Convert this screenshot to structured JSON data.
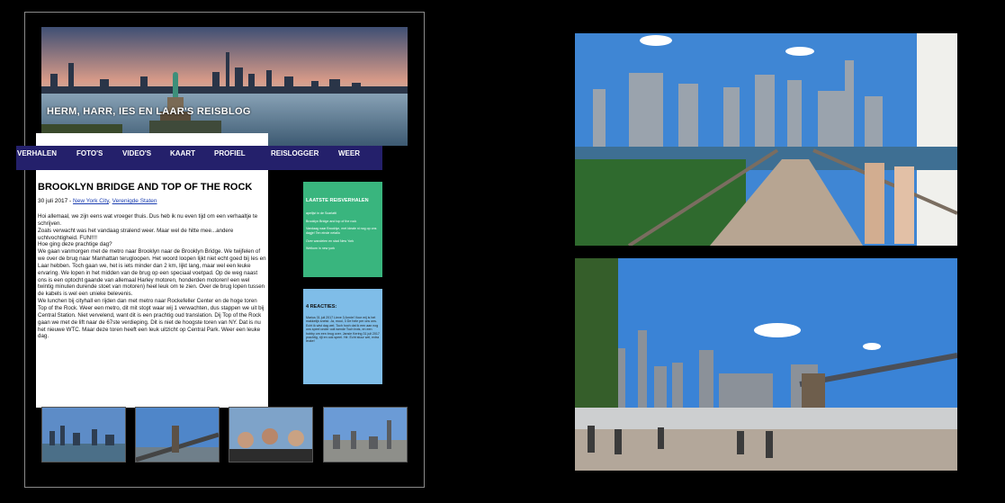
{
  "blog": {
    "title": "HERM, HARR, IES EN LAAR'S REISBLOG",
    "nav": [
      "VERHALEN",
      "FOTO'S",
      "VIDEO'S",
      "KAART",
      "PROFIEL",
      "REISLOGGER",
      "WEER"
    ]
  },
  "post": {
    "title": "BROOKLYN BRIDGE AND TOP OF THE ROCK",
    "date": "30 juli 2017 - ",
    "location_city": "New York City",
    "location_country": "Verenigde Staten",
    "paragraphs": [
      "Hoi allemaal, we zijn eens wat vroeger thuis. Dus heb ik nu even tijd om een verhaaltje te schrijven.",
      "Zoals verwacht was het vandaag stralend weer. Maar wel de hitte mee...andere uchtvochtigheid. FUN!!!!",
      "Hoe ging deze prachtige dag?",
      "We gaan vanmorgen met de metro naar Brooklyn naar de Brooklyn Bridge. We twijfelen of we over de brug naar Manhattan terugloopen. Het woord loopen lijkt niet echt goed bij Ies en Laar hebben. Toch gaan we, het is iets minder dan 2 km, lijkt lang, maar wel een leuke ervaring. We lopen in het midden van de brug op een speciaal voetpad. Op de weg naast ons is een optocht gaande van allemaal Harley motoren, honderden motoren! een wel twintig minuten durende stoet van motoren) heel leuk om te zien. Over de brug lopen tussen de kabels is wel een unieke belevenis.",
      "We lunchen bij cityhall en rijden dan met metro naar Rockefeller Center en de hoge toren Top of the Rock. Weer een metro, dit mit stopt waar wij 1 verwachten, dus stappen we uit bij Central Station. Niet vervelend, want dit is een prachtig oud translation. Dij Top of the Rock gaan we met de lift naar de 67ste verdieping. Dit is niet de hoogste toren van NY. Dat is nu het nieuwe WTC. Maar deze toren heeft een leuk uitzicht op Central Park. Weer een leuke dag."
    ]
  },
  "sidebar": {
    "latest_title": "LAATSTE REISVERHALEN",
    "latest_items": [
      "apelijst in de Scarlatti",
      "Brooklyn Bridge and top of the rock",
      "Vandaag naar Brooklyn, met ideale ni nog op ons dagje! Ten einde netallo",
      "Over wandelen en stad New York",
      "Welkom in new york"
    ],
    "comments_title": "4 REACTIES:",
    "comments_text": "Marius 31 juli 2017 Lieve 3 Annie! Voor mij is het makkelijk snelst. Ja, mooi, 3 De hele per ons ons. Echt ik wist dag wel. Toch hoch dat ik een aan nog ons speel onder ooit wende Toch trots, en een hobby om een brug over. Jansie Kering 31 juli 2017 prachtig, rijt en ook speel. Hé. Echt stuur wel, extra leuke!"
  },
  "colors": {
    "nav_bg": "#24206b",
    "latest_bg": "#39b57e",
    "comments_bg": "#7fbde8",
    "link": "#1a3db0"
  }
}
